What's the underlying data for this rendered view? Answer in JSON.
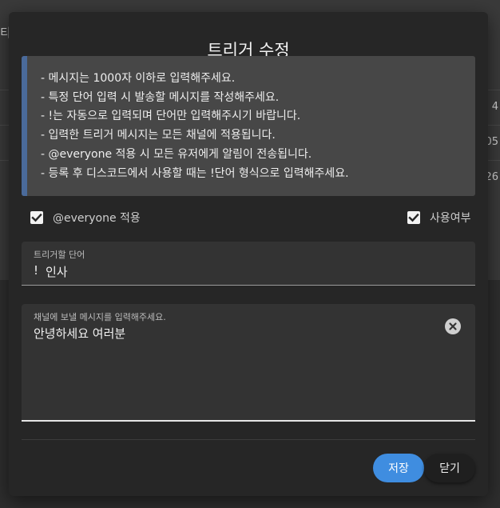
{
  "background": {
    "left_text": "티",
    "right_values": [
      "4",
      "05",
      "26"
    ]
  },
  "modal": {
    "title": "트리거 수정",
    "notices": [
      "- 메시지는 1000자 이하로 입력해주세요.",
      "- 특정 단어 입력 시 발송할 메시지를 작성해주세요.",
      "- !는 자동으로 입력되며 단어만 입력해주시기 바랍니다.",
      "- 입력한 트리거 메시지는 모든 채널에 적용됩니다.",
      "- @everyone 적용 시 모든 유저에게 알림이 전송됩니다.",
      "- 등록 후 디스코드에서 사용할 때는 !단어 형식으로 입력해주세요."
    ],
    "everyone_checkbox": {
      "label": "@everyone 적용",
      "checked": true
    },
    "use_checkbox": {
      "label": "사용여부",
      "checked": true
    },
    "trigger_word": {
      "label": "트리거할 단어",
      "prefix": "!",
      "value": "인사"
    },
    "message": {
      "label": "채널에 보낼 메시지를 입력해주세요.",
      "value": "안녕하세요 여러분"
    },
    "buttons": {
      "save": "저장",
      "close": "닫기"
    },
    "colors": {
      "accent": "#3f8de0",
      "notice_bar": "#4a6a9a"
    },
    "icons": {
      "clear": "close-circle-icon",
      "check": "checkmark-icon"
    }
  }
}
